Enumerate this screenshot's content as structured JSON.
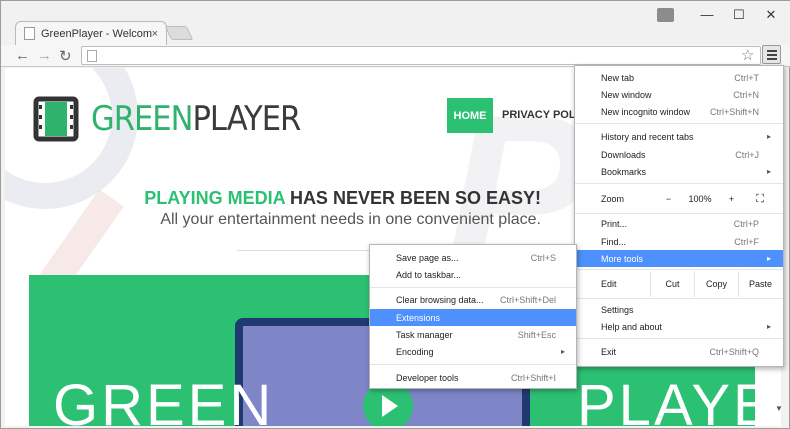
{
  "browser": {
    "tab_title": "GreenPlayer - Welcome!",
    "tab_close": "×",
    "window_controls": {
      "minimize": "—",
      "maximize": "☐",
      "close": "✕"
    },
    "nav": {
      "back": "←",
      "forward": "→",
      "reload": "↻"
    },
    "star": "☆"
  },
  "site": {
    "logo_green": "GREEN",
    "logo_dark": "PLAYER",
    "nav_home": "HOME",
    "nav_privacy": "PRIVACY POLICY",
    "headline_highlight": "PLAYING MEDIA",
    "headline_rest": " HAS NEVER BEEN SO EASY!",
    "subline": "All your entertainment needs in one convenient place.",
    "hero_left": "GREEN",
    "hero_right": "PLAYER",
    "accent_color": "#2cc073"
  },
  "chrome_menu": {
    "new_tab": "New tab",
    "new_tab_sc": "Ctrl+T",
    "new_window": "New window",
    "new_window_sc": "Ctrl+N",
    "new_incognito": "New incognito window",
    "new_incognito_sc": "Ctrl+Shift+N",
    "history": "History and recent tabs",
    "downloads": "Downloads",
    "downloads_sc": "Ctrl+J",
    "bookmarks": "Bookmarks",
    "zoom_label": "Zoom",
    "zoom_minus": "−",
    "zoom_value": "100%",
    "zoom_plus": "+",
    "fullscreen": "⛶",
    "print": "Print...",
    "print_sc": "Ctrl+P",
    "find": "Find...",
    "find_sc": "Ctrl+F",
    "more_tools": "More tools",
    "edit_label": "Edit",
    "cut": "Cut",
    "copy": "Copy",
    "paste": "Paste",
    "settings": "Settings",
    "help": "Help and about",
    "exit": "Exit",
    "exit_sc": "Ctrl+Shift+Q",
    "arrow": "▸"
  },
  "more_tools_menu": {
    "save_page": "Save page as...",
    "save_page_sc": "Ctrl+S",
    "add_taskbar": "Add to taskbar...",
    "clear_data": "Clear browsing data...",
    "clear_data_sc": "Ctrl+Shift+Del",
    "extensions": "Extensions",
    "task_manager": "Task manager",
    "task_manager_sc": "Shift+Esc",
    "encoding": "Encoding",
    "dev_tools": "Developer tools",
    "dev_tools_sc": "Ctrl+Shift+I"
  }
}
